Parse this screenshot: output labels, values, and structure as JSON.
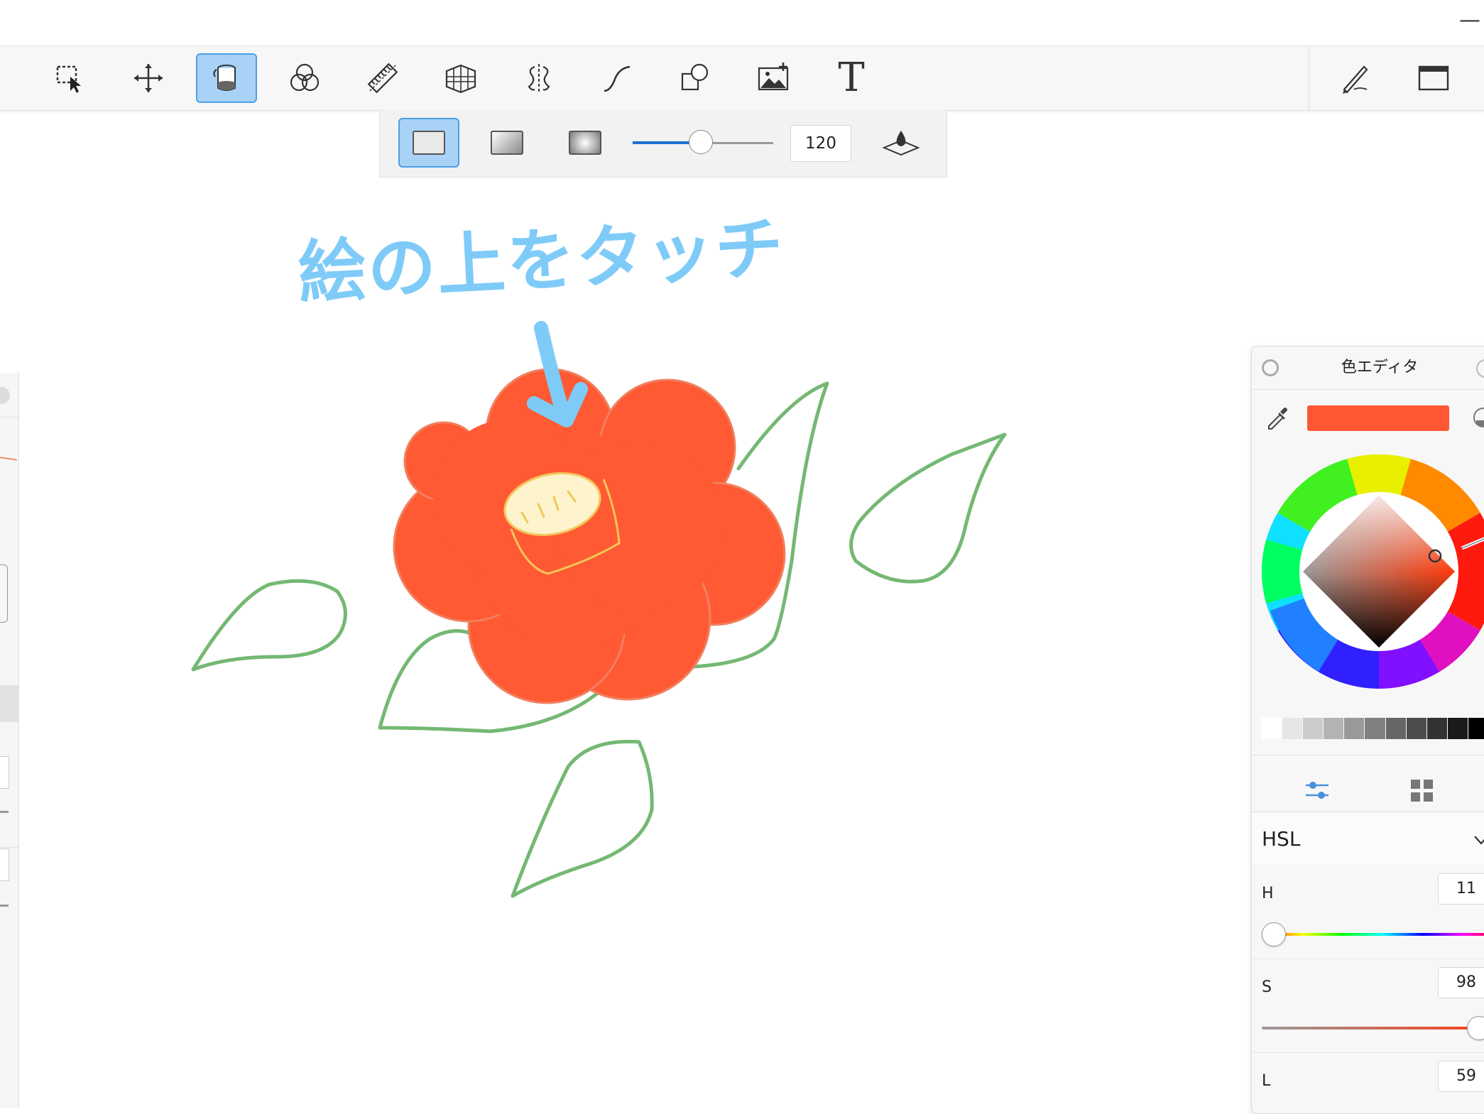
{
  "window": {
    "minimize_glyph": "—"
  },
  "toolbar": {
    "tools": [
      {
        "name": "selection-tool",
        "active": false
      },
      {
        "name": "move-tool",
        "active": false
      },
      {
        "name": "fill-tool",
        "active": true
      },
      {
        "name": "blend-tool",
        "active": false
      },
      {
        "name": "ruler-tool",
        "active": false
      },
      {
        "name": "perspective-tool",
        "active": false
      },
      {
        "name": "symmetry-tool",
        "active": false
      },
      {
        "name": "curve-tool",
        "active": false
      },
      {
        "name": "shape-tool",
        "active": false
      },
      {
        "name": "image-tool",
        "active": false
      },
      {
        "name": "text-tool",
        "active": false
      }
    ],
    "text_tool_glyph": "T"
  },
  "fill_options": {
    "modes": [
      "solid",
      "linear-gradient",
      "radial-gradient"
    ],
    "active_mode": "solid",
    "tolerance_value": "120",
    "tolerance_fraction": 0.48
  },
  "canvas": {
    "annotation": "絵の上をタッチ",
    "colors": {
      "flower": "#ff5a33",
      "leaf": "#74b873",
      "center": "#fdf3cc",
      "annotation": "#7fcbf8"
    }
  },
  "color_editor": {
    "title": "色エディタ",
    "current_color": "#ff5733",
    "gray_swatches": [
      "#ffffff",
      "#e6e6e6",
      "#cccccc",
      "#b3b3b3",
      "#999999",
      "#808080",
      "#666666",
      "#4d4d4d",
      "#333333",
      "#1a1a1a",
      "#000000"
    ],
    "mode": "HSL",
    "hsl": {
      "h_label": "H",
      "h_value": "11",
      "s_label": "S",
      "s_value": "98",
      "l_label": "L",
      "l_value": "59"
    }
  }
}
